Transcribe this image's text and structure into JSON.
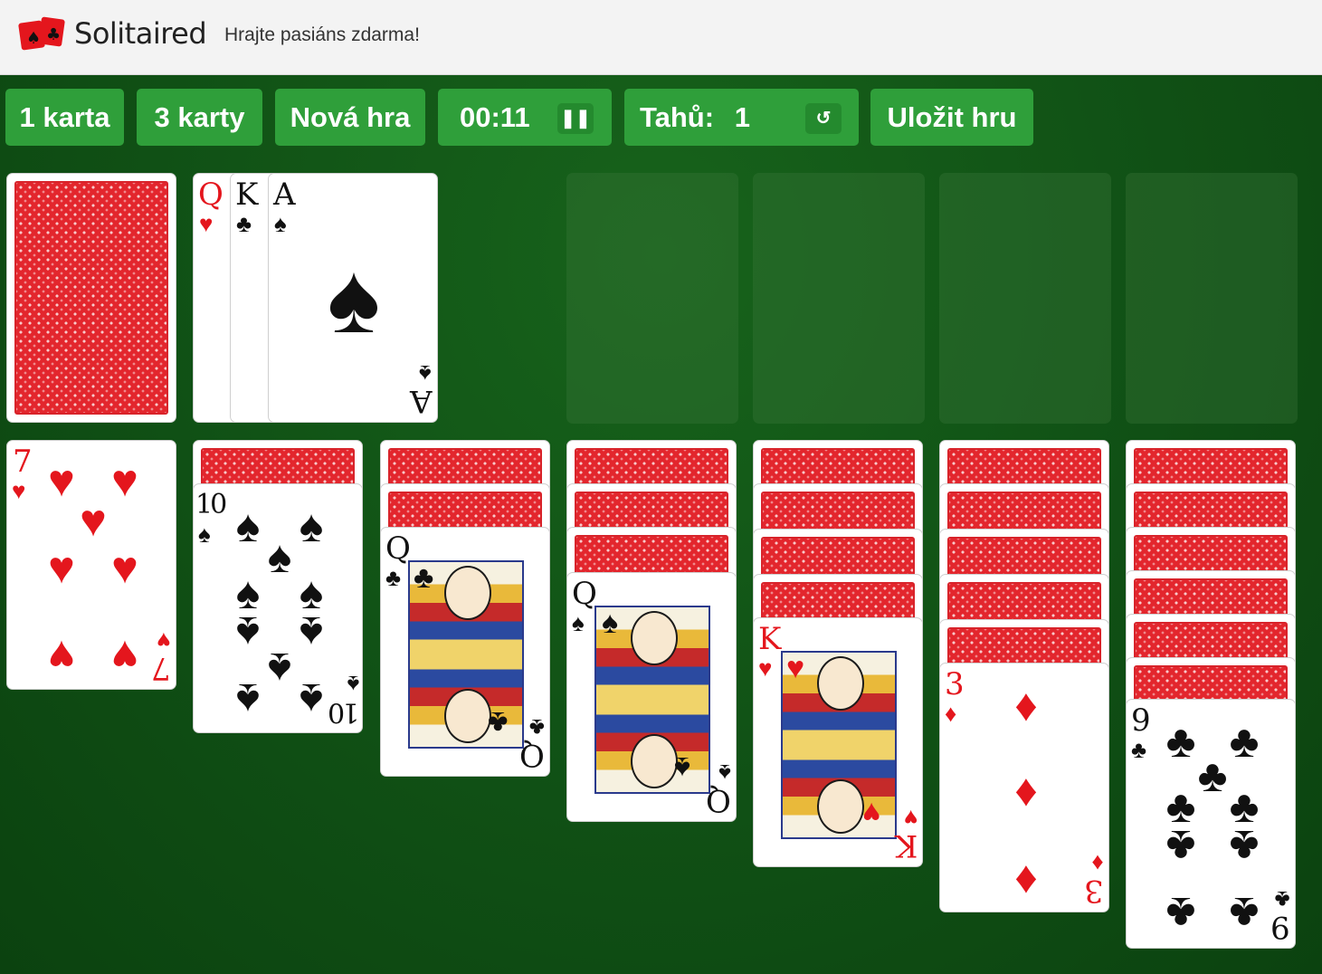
{
  "header": {
    "brand": "Solitaired",
    "tagline": "Hrajte pasiáns zdarma!",
    "logo_icon": "playing-cards-logo"
  },
  "toolbar": {
    "one_card": "1 karta",
    "three_cards": "3 karty",
    "new_game": "Nová hra",
    "timer": "00:11",
    "pause_icon": "pause-icon",
    "moves_label": "Tahů:",
    "moves_value": "1",
    "undo_icon": "undo-icon",
    "save_game": "Uložit hru"
  },
  "colors": {
    "felt": "#105015",
    "button": "#2f9f3a",
    "card_back": "#e3262d",
    "red_suit": "#e4161d"
  },
  "stock": {
    "face_down": true
  },
  "waste": [
    {
      "rank": "Q",
      "suit": "♥"
    },
    {
      "rank": "K",
      "suit": "♣"
    },
    {
      "rank": "A",
      "suit": "♠"
    }
  ],
  "foundations": [
    {},
    {},
    {},
    {}
  ],
  "tableau": [
    {
      "face_down": 0,
      "top": {
        "rank": "7",
        "suit": "♥"
      }
    },
    {
      "face_down": 1,
      "top": {
        "rank": "10",
        "suit": "♠"
      }
    },
    {
      "face_down": 2,
      "top": {
        "rank": "Q",
        "suit": "♣"
      }
    },
    {
      "face_down": 3,
      "top": {
        "rank": "Q",
        "suit": "♠"
      }
    },
    {
      "face_down": 4,
      "top": {
        "rank": "K",
        "suit": "♥"
      }
    },
    {
      "face_down": 5,
      "top": {
        "rank": "3",
        "suit": "♦"
      }
    },
    {
      "face_down": 6,
      "top": {
        "rank": "9",
        "suit": "♣"
      }
    }
  ]
}
